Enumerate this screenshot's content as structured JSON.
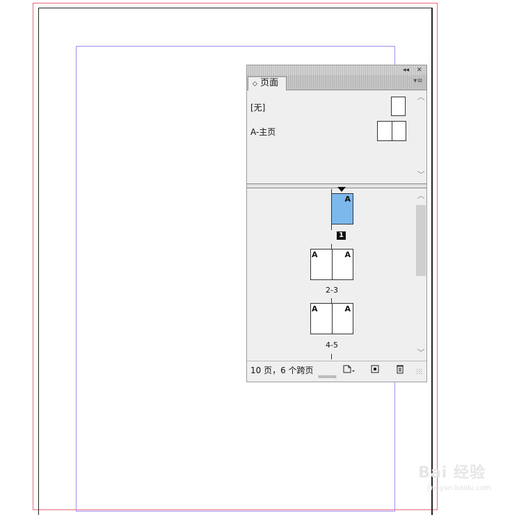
{
  "panel": {
    "title_buttons": {
      "collapse": "◂◂",
      "close": "✕"
    },
    "tab_label": "页面",
    "tab_icon": "◇",
    "menu_icon": "▾≡"
  },
  "masters": [
    {
      "label": "[无]",
      "type": "single"
    },
    {
      "label": "A-主页",
      "type": "spread"
    }
  ],
  "pages": [
    {
      "number_label": "1",
      "left_master": "",
      "right_master": "A",
      "selected": true
    },
    {
      "number_label": "2-3",
      "left_master": "A",
      "right_master": "A",
      "selected": false
    },
    {
      "number_label": "4-5",
      "left_master": "A",
      "right_master": "A",
      "selected": false
    }
  ],
  "footer": {
    "status": "10 页，6 个跨页",
    "icons": [
      "edit-page-size-icon",
      "new-page-icon",
      "delete-page-icon"
    ]
  },
  "colors": {
    "selected_page": "#7db8ec",
    "bleed_guide": "#e8687a",
    "margin_guide": "#a08cf0"
  },
  "watermark": {
    "main": "Bai 经验",
    "sub": "jingyan.baidu.com"
  }
}
